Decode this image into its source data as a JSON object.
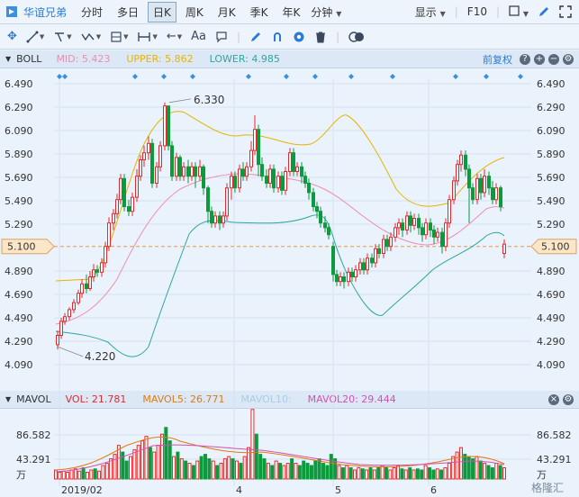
{
  "topbar": {
    "stock_name": "华谊兄弟",
    "tabs": [
      "分时",
      "多日",
      "日K",
      "周K",
      "月K",
      "季K",
      "年K"
    ],
    "active_tab": "日K",
    "more": "分钟",
    "display": "显示",
    "f10": "F10"
  },
  "boll": {
    "title": "BOLL",
    "mid_label": "MID: 5.423",
    "upper_label": "UPPER: 5.862",
    "lower_label": "LOWER: 4.985",
    "adjust": "前复权",
    "high_note": "6.330",
    "low_note": "4.220",
    "current_price": "5.100",
    "y_ticks": [
      "6.490",
      "6.290",
      "6.090",
      "5.890",
      "5.690",
      "5.490",
      "5.290",
      "5.100",
      "4.890",
      "4.690",
      "4.490",
      "4.290",
      "4.090"
    ]
  },
  "mavol": {
    "title": "MAVOL",
    "vol_label": "VOL: 21.781",
    "mavol5_label": "MAVOL5: 26.771",
    "mavol10_label": "MAVOL10:",
    "mavol20_label": "MAVOL20: 29.444",
    "y_ticks": [
      "86.582",
      "43.291",
      "万"
    ]
  },
  "xaxis": [
    "2019/02",
    "4",
    "5",
    "6"
  ],
  "watermark": "格隆汇",
  "colors": {
    "up": "#e8262b",
    "down": "#0a9b3d",
    "mid": "#f08cb0",
    "upper": "#e6b400",
    "lower": "#2aa7a0",
    "accent": "#2a7ad4"
  }
}
